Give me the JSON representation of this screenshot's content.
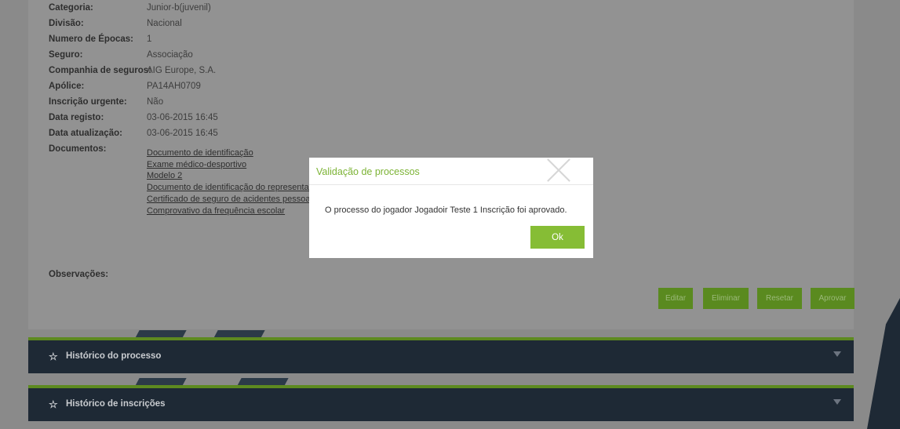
{
  "details": [
    {
      "label": "Categoria:",
      "value": "Junior-b(juvenil)"
    },
    {
      "label": "Divisão:",
      "value": "Nacional"
    },
    {
      "label": "Numero de Épocas:",
      "value": "1"
    },
    {
      "label": "Seguro:",
      "value": "Associação"
    },
    {
      "label": "Companhia de seguros:",
      "value": "AIG Europe, S.A."
    },
    {
      "label": "Apólice:",
      "value": "PA14AH0709"
    },
    {
      "label": "Inscrição urgente:",
      "value": "Não"
    },
    {
      "label": "Data registo:",
      "value": "03-06-2015 16:45"
    },
    {
      "label": "Data atualização:",
      "value": "03-06-2015 16:45"
    }
  ],
  "documents": {
    "label": "Documentos:",
    "links": [
      "Documento de identificação",
      "Exame médico-desportivo",
      "Modelo 2",
      "Documento de identificação do representan",
      "Certificado de seguro de acidentes pessoais",
      "Comprovativo da frequência escolar"
    ]
  },
  "observations_label": "Observações:",
  "actions": {
    "edit": "Editar",
    "delete": "Eliminar",
    "reset": "Resetar",
    "approve": "Aprovar"
  },
  "sections": {
    "history_process": "Histórico do processo",
    "history_registrations": "Histórico de inscrições"
  },
  "modal": {
    "title": "Validação de processos",
    "message": "O processo do jogador Jogadoir Teste 1 Inscrição foi aprovado.",
    "ok": "Ok"
  },
  "colors": {
    "accent": "#86bd35",
    "dark_bar": "#1e2935"
  }
}
